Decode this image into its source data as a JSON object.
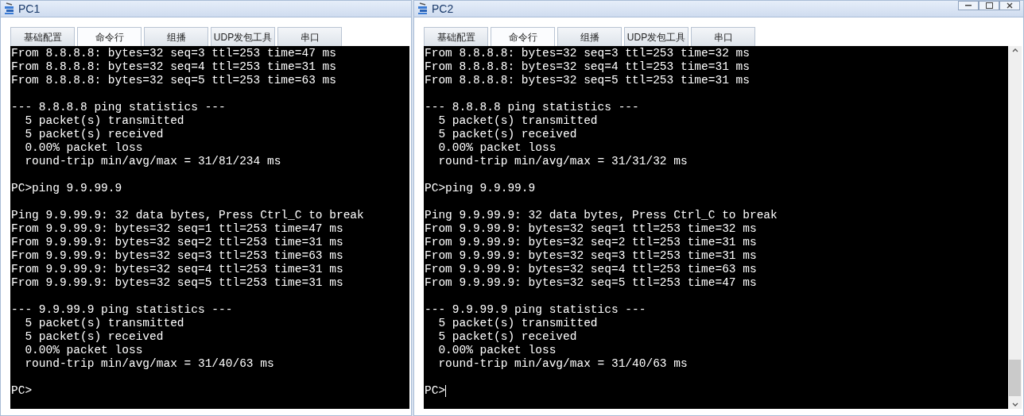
{
  "windows": [
    {
      "title": "PC1",
      "controls": false,
      "scrollbar": false,
      "tabs": [
        {
          "label": "基础配置",
          "selected": false
        },
        {
          "label": "命令行",
          "selected": true
        },
        {
          "label": "组播",
          "selected": false
        },
        {
          "label": "UDP发包工具",
          "selected": false
        },
        {
          "label": "串口",
          "selected": false
        }
      ],
      "terminal": {
        "cursor": false,
        "blocks": [
          [
            "From 8.8.8.8: bytes=32 seq=3 ttl=253 time=47 ms",
            "From 8.8.8.8: bytes=32 seq=4 ttl=253 time=31 ms",
            "From 8.8.8.8: bytes=32 seq=5 ttl=253 time=63 ms"
          ],
          [
            "--- 8.8.8.8 ping statistics ---",
            "  5 packet(s) transmitted",
            "  5 packet(s) received",
            "  0.00% packet loss",
            "  round-trip min/avg/max = 31/81/234 ms"
          ],
          [
            "PC>ping 9.9.99.9"
          ],
          [
            "Ping 9.9.99.9: 32 data bytes, Press Ctrl_C to break",
            "From 9.9.99.9: bytes=32 seq=1 ttl=253 time=47 ms",
            "From 9.9.99.9: bytes=32 seq=2 ttl=253 time=31 ms",
            "From 9.9.99.9: bytes=32 seq=3 ttl=253 time=63 ms",
            "From 9.9.99.9: bytes=32 seq=4 ttl=253 time=31 ms",
            "From 9.9.99.9: bytes=32 seq=5 ttl=253 time=31 ms"
          ],
          [
            "--- 9.9.99.9 ping statistics ---",
            "  5 packet(s) transmitted",
            "  5 packet(s) received",
            "  0.00% packet loss",
            "  round-trip min/avg/max = 31/40/63 ms"
          ],
          [
            "PC>"
          ]
        ]
      }
    },
    {
      "title": "PC2",
      "controls": true,
      "scrollbar": true,
      "tabs": [
        {
          "label": "基础配置",
          "selected": false
        },
        {
          "label": "命令行",
          "selected": true
        },
        {
          "label": "组播",
          "selected": false
        },
        {
          "label": "UDP发包工具",
          "selected": false
        },
        {
          "label": "串口",
          "selected": false
        }
      ],
      "terminal": {
        "cursor": true,
        "blocks": [
          [
            "From 8.8.8.8: bytes=32 seq=3 ttl=253 time=32 ms",
            "From 8.8.8.8: bytes=32 seq=4 ttl=253 time=31 ms",
            "From 8.8.8.8: bytes=32 seq=5 ttl=253 time=31 ms"
          ],
          [
            "--- 8.8.8.8 ping statistics ---",
            "  5 packet(s) transmitted",
            "  5 packet(s) received",
            "  0.00% packet loss",
            "  round-trip min/avg/max = 31/31/32 ms"
          ],
          [
            "PC>ping 9.9.99.9"
          ],
          [
            "Ping 9.9.99.9: 32 data bytes, Press Ctrl_C to break",
            "From 9.9.99.9: bytes=32 seq=1 ttl=253 time=32 ms",
            "From 9.9.99.9: bytes=32 seq=2 ttl=253 time=31 ms",
            "From 9.9.99.9: bytes=32 seq=3 ttl=253 time=31 ms",
            "From 9.9.99.9: bytes=32 seq=4 ttl=253 time=63 ms",
            "From 9.9.99.9: bytes=32 seq=5 ttl=253 time=47 ms"
          ],
          [
            "--- 9.9.99.9 ping statistics ---",
            "  5 packet(s) transmitted",
            "  5 packet(s) received",
            "  0.00% packet loss",
            "  round-trip min/avg/max = 31/40/63 ms"
          ],
          [
            "PC>"
          ]
        ]
      }
    }
  ]
}
